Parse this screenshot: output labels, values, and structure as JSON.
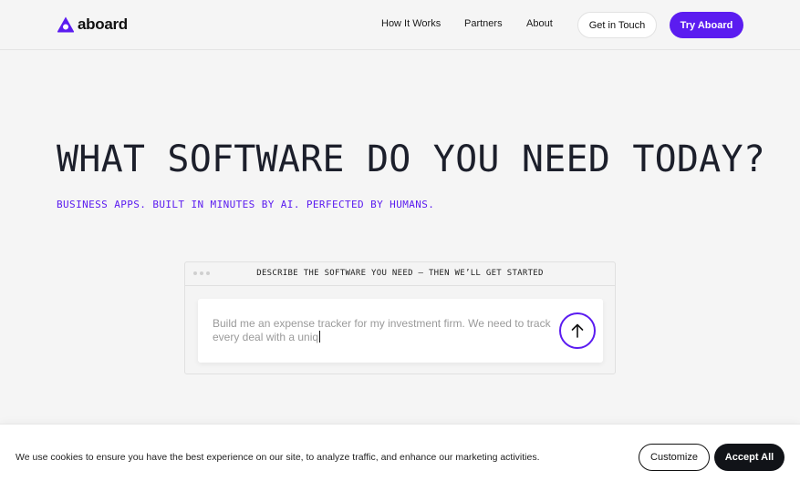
{
  "header": {
    "logo_text": "aboard",
    "logo_icon": "aboard-triangle-logo",
    "nav": [
      {
        "label": "How It Works"
      },
      {
        "label": "Partners"
      },
      {
        "label": "About"
      }
    ],
    "get_in_touch_label": "Get in Touch",
    "try_label": "Try Aboard"
  },
  "hero": {
    "title": "WHAT SOFTWARE DO YOU NEED TODAY?",
    "subtitle": "BUSINESS APPS. BUILT IN MINUTES BY AI. PERFECTED BY HUMANS."
  },
  "prompt": {
    "header_title": "DESCRIBE THE SOFTWARE YOU NEED – THEN WE’LL GET STARTED",
    "text_line1": "Build me an expense tracker for my investment firm. We need to track",
    "text_line2": "every deal with a uniq",
    "send_icon": "arrow-up-icon"
  },
  "cookie": {
    "message": "We use cookies to ensure you have the best experience on our site, to analyze traffic, and enhance our marketing activities.",
    "customize_label": "Customize",
    "accept_label": "Accept All"
  },
  "colors": {
    "brand": "#5b1cf0",
    "background": "#f5f5f5",
    "dark": "#111318"
  }
}
